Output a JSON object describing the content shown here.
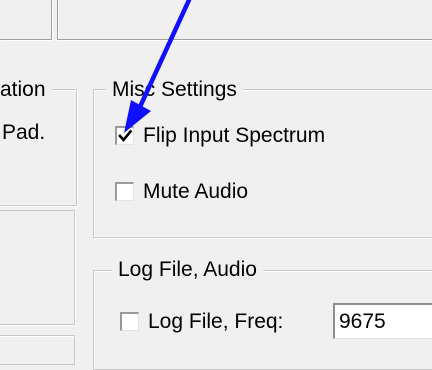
{
  "left_panel": {
    "partial_group_title": "ation",
    "partial_label": "Pad."
  },
  "misc_settings": {
    "title": "Misc Settings",
    "flip_input_spectrum": {
      "label": "Flip Input Spectrum",
      "checked": true
    },
    "mute_audio": {
      "label": "Mute Audio",
      "checked": false
    }
  },
  "log_file_audio": {
    "title": "Log File, Audio",
    "log_file_freq": {
      "label": "Log File, Freq:",
      "checked": false,
      "value": "9675"
    }
  },
  "annotation": {
    "arrow_color": "#1010ff"
  }
}
